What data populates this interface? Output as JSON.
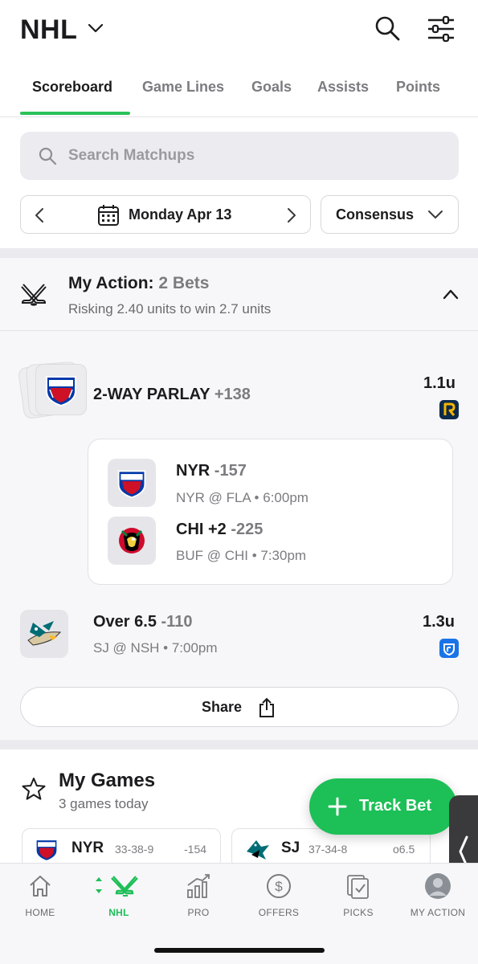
{
  "header": {
    "title": "NHL"
  },
  "tabs": [
    {
      "label": "Scoreboard",
      "active": true
    },
    {
      "label": "Game Lines"
    },
    {
      "label": "Goals"
    },
    {
      "label": "Assists"
    },
    {
      "label": "Points"
    }
  ],
  "search": {
    "placeholder": "Search Matchups"
  },
  "date_picker": {
    "label": "Monday Apr 13"
  },
  "consensus": {
    "label": "Consensus"
  },
  "my_action": {
    "title": "My Action:",
    "count": "2 Bets",
    "subtitle": "Risking 2.40 units to win 2.7 units",
    "parlay": {
      "label": "2-WAY PARLAY",
      "odds": "+138",
      "units": "1.1u",
      "legs": [
        {
          "pick": "NYR",
          "odds": "-157",
          "matchup": "NYR @ FLA • 6:00pm",
          "logo": "rangers-logo"
        },
        {
          "pick": "CHI +2",
          "odds": "-225",
          "matchup": "BUF @ CHI • 7:30pm",
          "logo": "blackhawks-logo"
        }
      ]
    },
    "single": {
      "pick": "Over 6.5",
      "odds": "-110",
      "matchup": "SJ @ NSH • 7:00pm",
      "units": "1.3u",
      "logo": "sharks-predators-logo"
    },
    "share_label": "Share"
  },
  "my_games": {
    "title": "My Games",
    "subtitle": "3 games today",
    "cards": [
      {
        "team": "NYR",
        "record": "33-38-9",
        "odds": "-154"
      },
      {
        "team": "SJ",
        "record": "37-34-8",
        "odds": "o6.5"
      }
    ]
  },
  "track_bet": {
    "label": "Track Bet"
  },
  "bottom_nav": [
    {
      "label": "HOME",
      "icon": "home-icon"
    },
    {
      "label": "NHL",
      "icon": "hockey-sticks-icon",
      "active": true
    },
    {
      "label": "PRO",
      "icon": "chart-icon"
    },
    {
      "label": "OFFERS",
      "icon": "dollar-icon"
    },
    {
      "label": "PICKS",
      "icon": "picks-icon"
    },
    {
      "label": "MY ACTION",
      "icon": "avatar-icon"
    }
  ],
  "colors": {
    "accent": "#1dbf57",
    "muted_text": "#7c7c80",
    "panel": "#f7f7f9"
  }
}
